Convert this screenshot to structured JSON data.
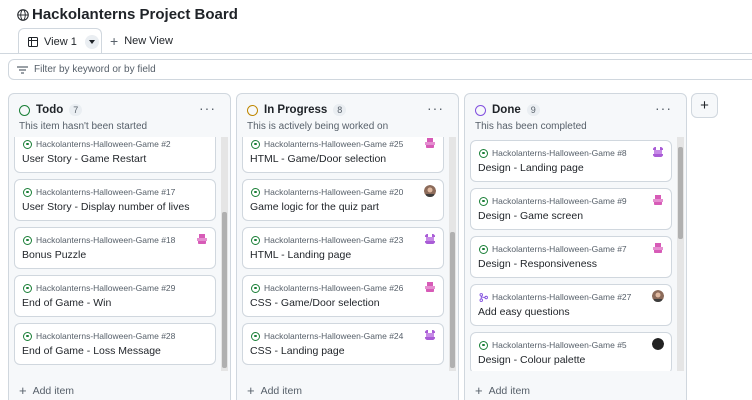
{
  "board": {
    "title": "Hackolanterns Project Board",
    "icon": "globe-icon"
  },
  "tabs": {
    "view1_label": "View 1",
    "new_view_label": "New View"
  },
  "filter": {
    "placeholder": "Filter by keyword or by field"
  },
  "columns": [
    {
      "title": "Todo",
      "count": "7",
      "description": "This item hasn't been started",
      "status_color": "#1a7f37",
      "add_label": "Add item",
      "cards": [
        {
          "meta": "Hackolanterns-Halloween-Game #2",
          "title": "User Story - Game Restart"
        },
        {
          "meta": "Hackolanterns-Halloween-Game #17",
          "title": "User Story - Display number of lives"
        },
        {
          "meta": "Hackolanterns-Halloween-Game #18",
          "title": "Bonus Puzzle"
        },
        {
          "meta": "Hackolanterns-Halloween-Game #29",
          "title": "End of Game - Win"
        },
        {
          "meta": "Hackolanterns-Halloween-Game #28",
          "title": "End of Game - Loss Message"
        }
      ]
    },
    {
      "title": "In Progress",
      "count": "8",
      "description": "This is actively being worked on",
      "status_color": "#bf8700",
      "add_label": "Add item",
      "cards": [
        {
          "meta": "Hackolanterns-Halloween-Game #25",
          "title": "HTML - Game/Door selection"
        },
        {
          "meta": "Hackolanterns-Halloween-Game #20",
          "title": "Game logic for the quiz part"
        },
        {
          "meta": "Hackolanterns-Halloween-Game #23",
          "title": "HTML - Landing page"
        },
        {
          "meta": "Hackolanterns-Halloween-Game #26",
          "title": "CSS - Game/Door selection"
        },
        {
          "meta": "Hackolanterns-Halloween-Game #24",
          "title": "CSS - Landing page"
        }
      ]
    },
    {
      "title": "Done",
      "count": "9",
      "description": "This has been completed",
      "status_color": "#8250df",
      "add_label": "Add item",
      "cards": [
        {
          "meta": "Hackolanterns-Halloween-Game #8",
          "title": "Design - Landing page"
        },
        {
          "meta": "Hackolanterns-Halloween-Game #9",
          "title": "Design - Game screen"
        },
        {
          "meta": "Hackolanterns-Halloween-Game #7",
          "title": "Design - Responsiveness"
        },
        {
          "meta": "Hackolanterns-Halloween-Game #27",
          "title": "Add easy questions"
        },
        {
          "meta": "Hackolanterns-Halloween-Game #5",
          "title": "Design - Colour palette"
        }
      ]
    }
  ],
  "add_column_label": "+"
}
